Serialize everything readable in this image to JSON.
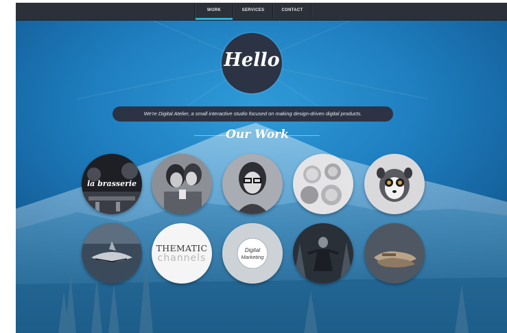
{
  "nav": {
    "items": [
      {
        "label": "WORK",
        "active": true
      },
      {
        "label": "SERVICES",
        "active": false
      },
      {
        "label": "CONTACT",
        "active": false
      }
    ]
  },
  "hero": {
    "greeting": "Hello",
    "tagline": "We're Digital Atelier, a small interactive studio focused on making design-driven digital products."
  },
  "work_section": {
    "title": "Our Work",
    "items": [
      {
        "label": "la brasserie",
        "kind": "restaurant-photo"
      },
      {
        "label": "",
        "kind": "two-women-photo"
      },
      {
        "label": "",
        "kind": "woman-glasses-photo"
      },
      {
        "label": "",
        "kind": "cupcakes-photo"
      },
      {
        "label": "",
        "kind": "lemur-photo"
      },
      {
        "label": "",
        "kind": "shark-photo"
      },
      {
        "label": "THEMATIC",
        "label2": "channels",
        "kind": "logo"
      },
      {
        "label": "Digital",
        "label2": "Marketing",
        "kind": "badge"
      },
      {
        "label": "",
        "kind": "forest-man-photo"
      },
      {
        "label": "",
        "kind": "shoes-photo"
      }
    ]
  },
  "colors": {
    "nav_bg": "#2c3038",
    "nav_active_accent": "#26b3d9",
    "background_blue": "#1f7fc0",
    "dark_pill": "#2c3344"
  }
}
